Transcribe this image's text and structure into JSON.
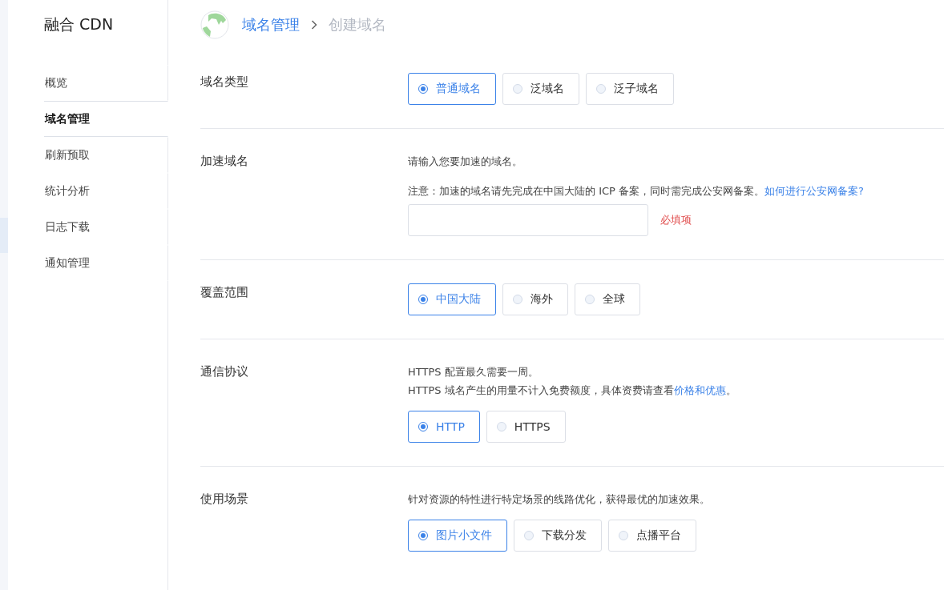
{
  "brand": "融合 CDN",
  "nav": [
    {
      "label": "概览",
      "selected": false
    },
    {
      "label": "域名管理",
      "selected": true
    },
    {
      "label": "刷新预取",
      "selected": false
    },
    {
      "label": "统计分析",
      "selected": false
    },
    {
      "label": "日志下载",
      "selected": false
    },
    {
      "label": "通知管理",
      "selected": false
    }
  ],
  "breadcrumb": {
    "parent": "域名管理",
    "current": "创建域名"
  },
  "sections": [
    {
      "label": "域名类型",
      "kind": "radio",
      "options": [
        {
          "label": "普通域名",
          "selected": true
        },
        {
          "label": "泛域名",
          "selected": false
        },
        {
          "label": "泛子域名",
          "selected": false
        }
      ]
    },
    {
      "label": "加速域名",
      "kind": "text_input",
      "notes": [
        {
          "text": "请输入您要加速的域名。"
        },
        {
          "text": "注意：加速的域名请先完成在中国大陆的 ICP 备案，同时需完成公安网备案。",
          "link": "如何进行公安网备案?"
        }
      ],
      "required": "必填项"
    },
    {
      "label": "覆盖范围",
      "kind": "radio",
      "options": [
        {
          "label": "中国大陆",
          "selected": true
        },
        {
          "label": "海外",
          "selected": false
        },
        {
          "label": "全球",
          "selected": false
        }
      ]
    },
    {
      "label": "通信协议",
      "kind": "radio",
      "notes": [
        {
          "text": "HTTPS 配置最久需要一周。"
        },
        {
          "text": "HTTPS 域名产生的用量不计入免费额度，具体资费请查看",
          "link": "价格和优惠",
          "after": "。"
        }
      ],
      "options": [
        {
          "label": "HTTP",
          "selected": true
        },
        {
          "label": "HTTPS",
          "selected": false
        }
      ]
    },
    {
      "label": "使用场景",
      "kind": "radio",
      "notes": [
        {
          "text": "针对资源的特性进行特定场景的线路优化，获得最优的加速效果。"
        }
      ],
      "options": [
        {
          "label": "图片小文件",
          "selected": true
        },
        {
          "label": "下载分发",
          "selected": false
        },
        {
          "label": "点播平台",
          "selected": false
        }
      ]
    }
  ]
}
